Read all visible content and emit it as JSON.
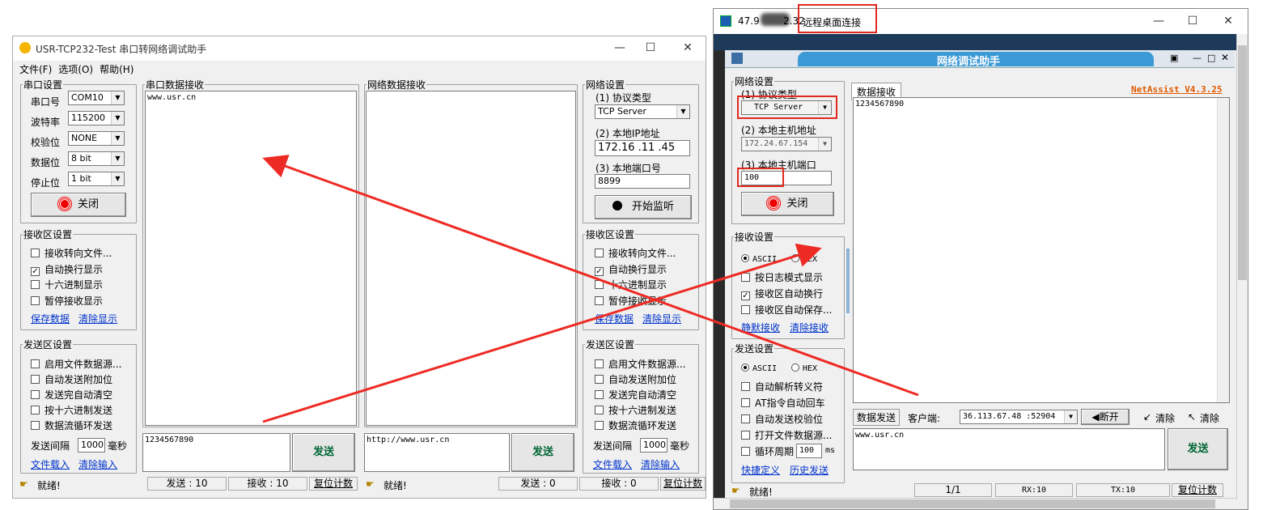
{
  "left": {
    "title": "USR-TCP232-Test 串口转网络调试助手",
    "menu": [
      "文件(F)",
      "选项(O)",
      "帮助(H)"
    ],
    "serial": {
      "legend": "串口设置",
      "port_label": "串口号",
      "port": "COM10",
      "baud_label": "波特率",
      "baud": "115200",
      "parity_label": "校验位",
      "parity": "NONE",
      "data_label": "数据位",
      "data": "8 bit",
      "stop_label": "停止位",
      "stop": "1 bit",
      "close_btn": "关闭"
    },
    "serial_recv": {
      "legend": "串口数据接收",
      "content": "www.usr.cn"
    },
    "net_recv": {
      "legend": "网络数据接收",
      "content": ""
    },
    "net": {
      "legend": "网络设置",
      "proto_label": "(1) 协议类型",
      "proto": "TCP Server",
      "ip_label": "(2) 本地IP地址",
      "ip": "172.16 .11 .45",
      "port_label": "(3) 本地端口号",
      "port": "8899",
      "listen_btn": "开始监听"
    },
    "recv_settings": {
      "legend": "接收区设置",
      "items": [
        {
          "label": "接收转向文件...",
          "checked": false
        },
        {
          "label": "自动换行显示",
          "checked": true
        },
        {
          "label": "十六进制显示",
          "checked": false
        },
        {
          "label": "暂停接收显示",
          "checked": false
        }
      ],
      "save": "保存数据",
      "clear": "清除显示"
    },
    "send_settings": {
      "legend": "发送区设置",
      "items": [
        {
          "label": "启用文件数据源...",
          "checked": false
        },
        {
          "label": "自动发送附加位",
          "checked": false
        },
        {
          "label": "发送完自动清空",
          "checked": false
        },
        {
          "label": "按十六进制发送",
          "checked": false
        },
        {
          "label": "数据流循环发送",
          "checked": false
        }
      ],
      "interval_label": "发送间隔",
      "interval": "1000",
      "unit": "毫秒",
      "load": "文件载入",
      "clear": "清除输入"
    },
    "serial_send": {
      "content": "1234567890",
      "btn": "发送"
    },
    "net_send": {
      "content": "http://www.usr.cn",
      "btn": "发送"
    },
    "status": {
      "ready": "就绪!",
      "sent1": "发送 : 10",
      "recv1": "接收 : 10",
      "reset1": "复位计数",
      "ready2": "就绪!",
      "sent2": "发送 : 0",
      "recv2": "接收 : 0",
      "reset2": "复位计数"
    }
  },
  "right": {
    "title_ip": "47.9",
    "title_ip_tail": "2.32",
    "title": " - 远程桌面连接",
    "app_title": "网络调试助手",
    "brand": "NetAssist V4.3.25",
    "net": {
      "legend": "网络设置",
      "proto_label": "(1) 协议类型",
      "proto": "TCP Server",
      "host_label": "(2) 本地主机地址",
      "host": "172.24.67.154",
      "port_label": "(3) 本地主机端口",
      "port": "100",
      "close_btn": "关闭"
    },
    "recv_settings": {
      "legend": "接收设置",
      "ascii": "ASCII",
      "hex": "HEX",
      "items": [
        {
          "label": "按日志模式显示",
          "checked": false
        },
        {
          "label": "接收区自动换行",
          "checked": true
        },
        {
          "label": "接收区自动保存...",
          "checked": false
        }
      ],
      "save": "静默接收",
      "clear": "清除接收"
    },
    "send_settings": {
      "legend": "发送设置",
      "ascii": "ASCII",
      "hex": "HEX",
      "items": [
        {
          "label": "自动解析转义符",
          "checked": false
        },
        {
          "label": "AT指令自动回车",
          "checked": false
        },
        {
          "label": "自动发送校验位",
          "checked": false
        },
        {
          "label": "打开文件数据源...",
          "checked": false
        },
        {
          "label": "循环周期",
          "checked": false
        }
      ],
      "period": "100",
      "period_unit": "ms",
      "shortcut": "快捷定义",
      "history": "历史发送"
    },
    "recv_tab": "数据接收",
    "recv_content": "1234567890",
    "send_tab": "数据发送",
    "client_label": "客户端:",
    "client": "36.113.67.48 :52904",
    "disconnect": "断开",
    "clear1": "清除",
    "clear2": "清除",
    "send_content": "www.usr.cn",
    "send_btn": "发送",
    "status": {
      "ready": "就绪!",
      "page": "1/1",
      "rx": "RX:10",
      "tx": "TX:10",
      "reset": "复位计数"
    }
  }
}
